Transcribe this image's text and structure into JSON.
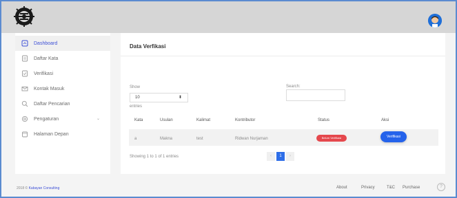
{
  "sidebar": {
    "items": [
      {
        "label": "Dashboard",
        "icon": "dashboard-icon",
        "active": true
      },
      {
        "label": "Daftar Kata",
        "icon": "document-icon",
        "active": false
      },
      {
        "label": "Verifikasi",
        "icon": "document-check-icon",
        "active": false
      },
      {
        "label": "Kontak Masuk",
        "icon": "mail-icon",
        "active": false
      },
      {
        "label": "Daftar Pencarian",
        "icon": "search-icon",
        "active": false
      },
      {
        "label": "Pengaturan",
        "icon": "settings-icon",
        "active": false,
        "has_submenu": true
      },
      {
        "label": "Halaman Depan",
        "icon": "calendar-icon",
        "active": false
      }
    ]
  },
  "card": {
    "title": "Data Verfikasi",
    "show_label": "Show",
    "entries_value": "10",
    "entries_label": "entries",
    "search_label": "Search:",
    "search_value": ""
  },
  "table": {
    "headers": [
      "Kata",
      "Usulan",
      "Kalimat",
      "Kontributor",
      "Status",
      "Aksi"
    ],
    "rows": [
      {
        "kata": "a",
        "usulan": "Makna",
        "kalimat": "test",
        "kontributor": "Ridwan Nurjaman",
        "status": "Belum Verifikasi",
        "aksi": "Verifikasi"
      }
    ],
    "info": "Showing 1 to 1 of 1 entries",
    "pagination": {
      "prev": "‹",
      "current": "1",
      "next": "›"
    }
  },
  "footer": {
    "copyright": "2018 ©",
    "brand": "Kabayan Consulting",
    "links": [
      "About",
      "Privacy",
      "T&C",
      "Purchase"
    ],
    "help": "?"
  },
  "colors": {
    "accent": "#3d4fd6",
    "primary_button": "#2563eb",
    "status_badge": "#e5484d",
    "topbar": "#d6d6d6",
    "frame_border": "#5b8bd0"
  }
}
